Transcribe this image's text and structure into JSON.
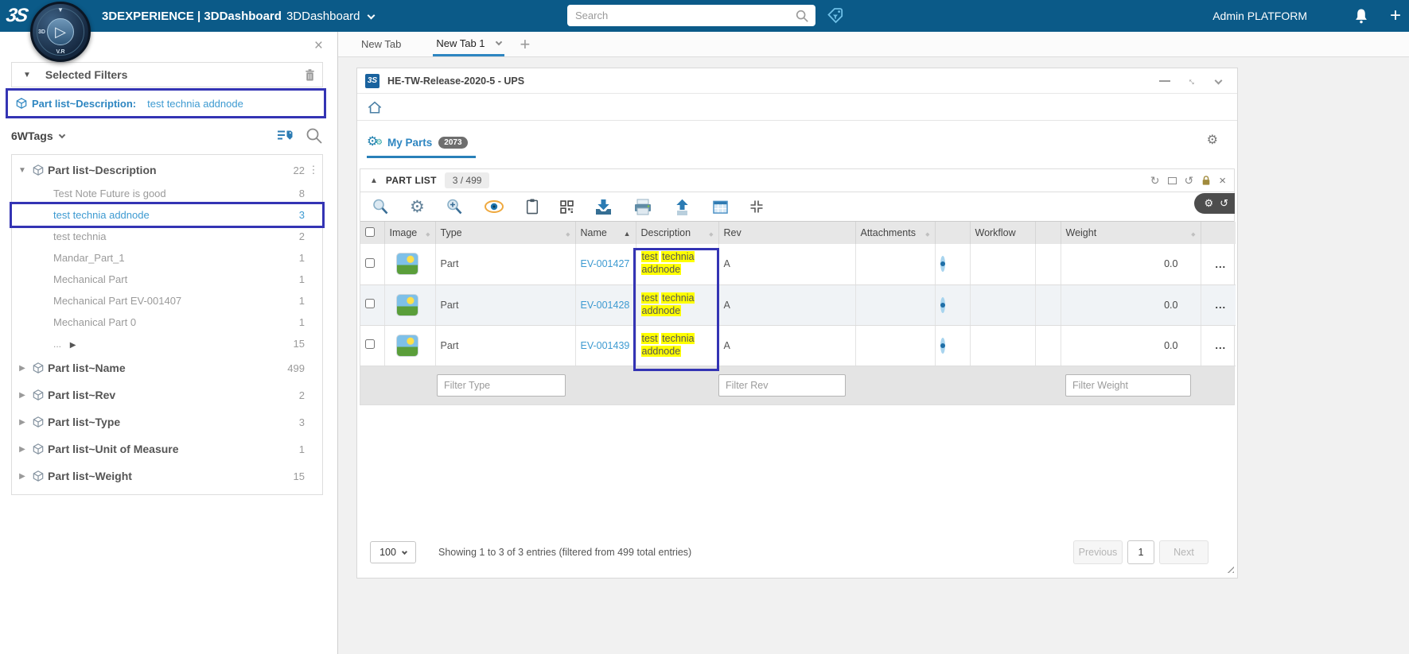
{
  "topbar": {
    "brand": "3DEXPERIENCE | 3DDashboard",
    "app": "3DDashboard",
    "search_placeholder": "Search",
    "user": "Admin PLATFORM",
    "add": "+",
    "logo": "3S",
    "compass": {
      "left": "3D",
      "bottom": "V.R"
    }
  },
  "sidebar": {
    "close": "×",
    "selected_filters_title": "Selected Filters",
    "chip": {
      "label": "Part list~Description:",
      "value": "test technia addnode"
    },
    "tags_label": "6WTags",
    "tree": {
      "group": {
        "label": "Part list~Description",
        "count": "22",
        "menu": "⋮"
      },
      "items": [
        {
          "label": "Test Note Future is good",
          "count": "8"
        },
        {
          "label": "test technia addnode",
          "count": "3"
        },
        {
          "label": "test technia",
          "count": "2"
        },
        {
          "label": "Mandar_Part_1",
          "count": "1"
        },
        {
          "label": "Mechanical Part",
          "count": "1"
        },
        {
          "label": "Mechanical Part EV-001407",
          "count": "1"
        },
        {
          "label": "Mechanical Part 0",
          "count": "1"
        },
        {
          "label": "...",
          "count": "15"
        }
      ],
      "groups": [
        {
          "label": "Part list~Name",
          "count": "499"
        },
        {
          "label": "Part list~Rev",
          "count": "2"
        },
        {
          "label": "Part list~Type",
          "count": "3"
        },
        {
          "label": "Part list~Unit of Measure",
          "count": "1"
        },
        {
          "label": "Part list~Weight",
          "count": "15"
        }
      ]
    }
  },
  "tabs": {
    "first": "New Tab",
    "active": "New Tab 1",
    "add": "+"
  },
  "widget": {
    "title": "HE-TW-Release-2020-5 - UPS",
    "logo": "3S",
    "tab": {
      "label": "My Parts",
      "badge": "2073"
    },
    "panel": {
      "title": "PART LIST",
      "counter": "3 / 499"
    },
    "table": {
      "headers": [
        "Image",
        "Type",
        "Name",
        "Description",
        "Rev",
        "Attachments",
        "Workflow",
        "Weight"
      ],
      "actions_label": "...",
      "rows": [
        {
          "type": "Part",
          "name": "EV-001427",
          "desc": [
            "test",
            "technia",
            "addnode"
          ],
          "rev": "A",
          "weight": "0.0"
        },
        {
          "type": "Part",
          "name": "EV-001428",
          "desc": [
            "test",
            "technia",
            "addnode"
          ],
          "rev": "A",
          "weight": "0.0"
        },
        {
          "type": "Part",
          "name": "EV-001439",
          "desc": [
            "test",
            "technia",
            "addnode"
          ],
          "rev": "A",
          "weight": "0.0"
        }
      ]
    },
    "filters": {
      "type": "Filter Type",
      "rev": "Filter Rev",
      "weight": "Filter Weight"
    },
    "footer": {
      "page_size": "100",
      "showing": "Showing 1 to 3 of 3 entries (filtered from 499 total entries)",
      "previous": "Previous",
      "page": "1",
      "next": "Next"
    }
  },
  "colors": {
    "topbar": "#0b5a88",
    "accent": "#2e86c1",
    "link": "#3d9ad1",
    "annotation": "#3434b4",
    "highlight": "#ffff00",
    "badge_bg": "#6e6e6e"
  },
  "icons": {
    "search-icon": "magnifier",
    "tag-filter-icon": "tag with funnel",
    "bell-icon": "bell",
    "add-icon": "plus",
    "trash-icon": "trash can",
    "cube-icon": "3d cube",
    "kebab-icon": "vertical dots",
    "list-tag-icon": "list lines with tag",
    "zoom-icon": "magnifier",
    "settings-gear-icon": "gear",
    "zoom-in-icon": "magnifier plus",
    "eye-icon": "eye",
    "clipboard-icon": "clipboard",
    "qr-icon": "qr grid",
    "download-icon": "arrow into tray",
    "print-icon": "printer",
    "upload-icon": "arrow up",
    "table-icon": "table grid",
    "collapse-icon": "inward arrows",
    "refresh-icon": "circular arrows",
    "maximize-icon": "rectangle",
    "undo-icon": "counterclockwise arrow",
    "lock-icon": "padlock",
    "close-icon": "x",
    "home-icon": "house",
    "resize-icon": "diagonal grip",
    "sort-asc-icon": "up triangle",
    "sort-icon": "diamond"
  }
}
